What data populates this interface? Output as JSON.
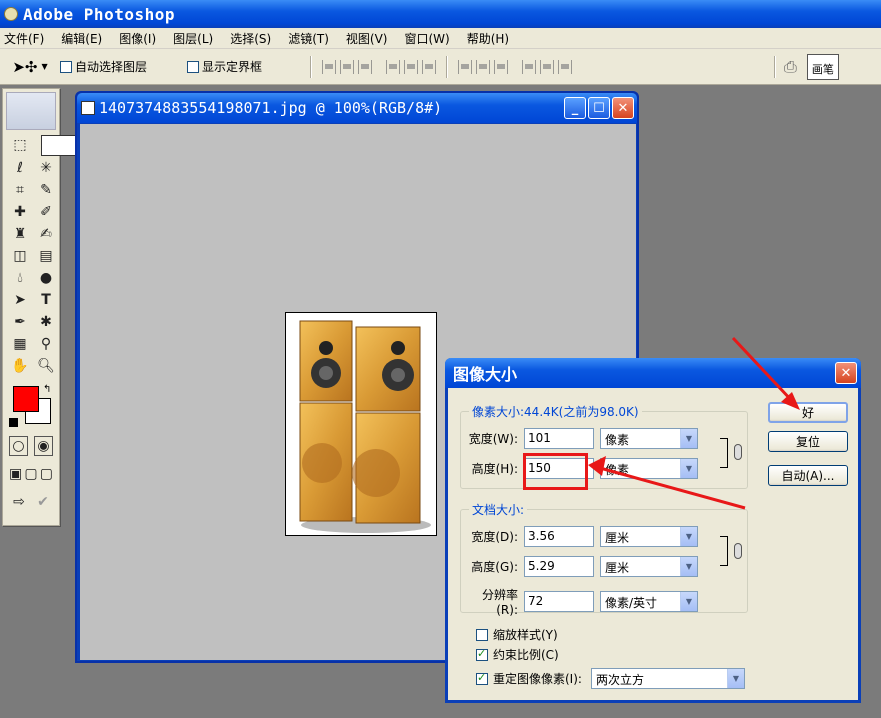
{
  "app": {
    "title": "Adobe Photoshop"
  },
  "menu": [
    "文件(F)",
    "编辑(E)",
    "图像(I)",
    "图层(L)",
    "选择(S)",
    "滤镜(T)",
    "视图(V)",
    "窗口(W)",
    "帮助(H)"
  ],
  "options": {
    "auto_select": "自动选择图层",
    "show_bounds": "显示定界框",
    "palette_tab": "画笔"
  },
  "document": {
    "title": "1407374883554198071.jpg @ 100%(RGB/8#)"
  },
  "colors": {
    "foreground": "#ff0000",
    "background": "#ffffff",
    "title_bar": "#0a58e0",
    "annotation": "#e81818"
  },
  "dialog": {
    "title": "图像大小",
    "pixel_dims_legend": "像素大小:44.4K(之前为98.0K)",
    "width_label": "宽度(W):",
    "width_value": "101",
    "width_unit": "像素",
    "height_label": "高度(H):",
    "height_value": "150",
    "height_unit": "像素",
    "doc_size_legend": "文档大小:",
    "doc_width_label": "宽度(D):",
    "doc_width_value": "3.56",
    "doc_width_unit": "厘米",
    "doc_height_label": "高度(G):",
    "doc_height_value": "5.29",
    "doc_height_unit": "厘米",
    "resolution_label": "分辨率(R):",
    "resolution_value": "72",
    "resolution_unit": "像素/英寸",
    "scale_styles": "缩放样式(Y)",
    "constrain": "约束比例(C)",
    "resample": "重定图像像素(I):",
    "resample_method": "两次立方",
    "ok": "好",
    "reset": "复位",
    "auto": "自动(A)..."
  }
}
